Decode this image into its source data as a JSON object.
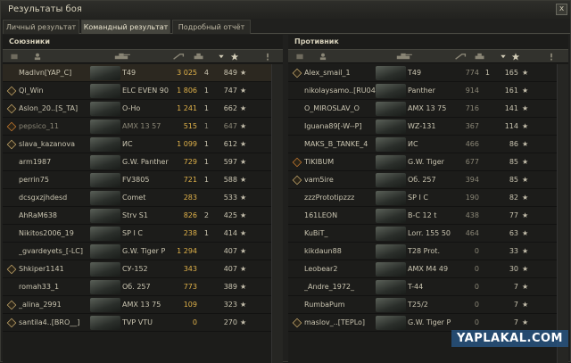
{
  "window": {
    "title": "Результаты боя",
    "close": "x"
  },
  "tabs": [
    {
      "label": "Личный результат",
      "active": false
    },
    {
      "label": "Командный результат",
      "active": true
    },
    {
      "label": "Подробный отчёт",
      "active": false
    }
  ],
  "allies": {
    "title": "Союзники",
    "players": [
      {
        "name": "Madlvn[YAP_C]",
        "tank": "T49",
        "dmg": "3 025",
        "kills": "4",
        "xp": "849",
        "badge": "none",
        "highlight": true
      },
      {
        "name": "Ql_Win",
        "tank": "ELC EVEN 90",
        "dmg": "1 806",
        "kills": "1",
        "xp": "747",
        "badge": "gold"
      },
      {
        "name": "Aslon_20..[S_TA]",
        "tank": "O-Ho",
        "dmg": "1 241",
        "kills": "1",
        "xp": "662",
        "badge": "gold"
      },
      {
        "name": "pepsico_11",
        "tank": "AMX 13 57",
        "dmg": "515",
        "kills": "1",
        "xp": "647",
        "badge": "orange",
        "dead": true
      },
      {
        "name": "slava_kazanova",
        "tank": "ИС",
        "dmg": "1 099",
        "kills": "1",
        "xp": "612",
        "badge": "gold"
      },
      {
        "name": "arm1987",
        "tank": "G.W. Panther",
        "dmg": "729",
        "kills": "1",
        "xp": "597",
        "badge": "none"
      },
      {
        "name": "perrin75",
        "tank": "FV3805",
        "dmg": "721",
        "kills": "1",
        "xp": "588",
        "badge": "none"
      },
      {
        "name": "dcsgxzjhdesd",
        "tank": "Comet",
        "dmg": "283",
        "kills": "",
        "xp": "533",
        "badge": "none"
      },
      {
        "name": "AhRaM638",
        "tank": "Strv S1",
        "dmg": "826",
        "kills": "2",
        "xp": "425",
        "badge": "none"
      },
      {
        "name": "Nikitos2006_19",
        "tank": "SP I C",
        "dmg": "238",
        "kills": "1",
        "xp": "414",
        "badge": "none"
      },
      {
        "name": "_gvardeyets_[-LC]",
        "tank": "G.W. Tiger P",
        "dmg": "1 294",
        "kills": "",
        "xp": "407",
        "badge": "none"
      },
      {
        "name": "Shkiper1141",
        "tank": "СУ-152",
        "dmg": "343",
        "kills": "",
        "xp": "407",
        "badge": "gold"
      },
      {
        "name": "romah33_1",
        "tank": "Об. 257",
        "dmg": "773",
        "kills": "",
        "xp": "389",
        "badge": "none"
      },
      {
        "name": "_alina_2991",
        "tank": "AMX 13 75",
        "dmg": "109",
        "kills": "",
        "xp": "323",
        "badge": "gold"
      },
      {
        "name": "santila4..[BRO__]",
        "tank": "TVP VTU",
        "dmg": "0",
        "kills": "",
        "xp": "270",
        "badge": "gold"
      }
    ]
  },
  "enemies": {
    "title": "Противник",
    "players": [
      {
        "name": "Alex_smail_1",
        "tank": "T49",
        "dmg": "774",
        "kills": "1",
        "xp": "165",
        "badge": "gold"
      },
      {
        "name": "nikolaysamo..[RU045]",
        "tank": "Panther",
        "dmg": "914",
        "kills": "",
        "xp": "161",
        "badge": "none"
      },
      {
        "name": "O_MIROSLAV_O",
        "tank": "AMX 13 75",
        "dmg": "716",
        "kills": "",
        "xp": "141",
        "badge": "none"
      },
      {
        "name": "Iguana89[-W--P]",
        "tank": "WZ-131",
        "dmg": "367",
        "kills": "",
        "xp": "114",
        "badge": "none"
      },
      {
        "name": "MAKS_B_TANKE_4",
        "tank": "ИС",
        "dmg": "466",
        "kills": "",
        "xp": "86",
        "badge": "none"
      },
      {
        "name": "TIKIBUM",
        "tank": "G.W. Tiger",
        "dmg": "677",
        "kills": "",
        "xp": "85",
        "badge": "orange"
      },
      {
        "name": "vam5ire",
        "tank": "Об. 257",
        "dmg": "394",
        "kills": "",
        "xp": "85",
        "badge": "gold"
      },
      {
        "name": "zzzPrototipzzz",
        "tank": "SP I C",
        "dmg": "190",
        "kills": "",
        "xp": "82",
        "badge": "none"
      },
      {
        "name": "161LEON",
        "tank": "B-C 12 t",
        "dmg": "438",
        "kills": "",
        "xp": "77",
        "badge": "none"
      },
      {
        "name": "KuBiT_",
        "tank": "Lorr. 155 50",
        "dmg": "464",
        "kills": "",
        "xp": "63",
        "badge": "none"
      },
      {
        "name": "kikdaun88",
        "tank": "T28 Prot.",
        "dmg": "0",
        "kills": "",
        "xp": "33",
        "badge": "none"
      },
      {
        "name": "Leobear2",
        "tank": "AMX M4 49",
        "dmg": "0",
        "kills": "",
        "xp": "30",
        "badge": "none"
      },
      {
        "name": "_Andre_1972_",
        "tank": "T-44",
        "dmg": "0",
        "kills": "",
        "xp": "7",
        "badge": "none"
      },
      {
        "name": "RumbaPum",
        "tank": "T25/2",
        "dmg": "0",
        "kills": "",
        "xp": "7",
        "badge": "none"
      },
      {
        "name": "maslov_..[TEPLo]",
        "tank": "G.W. Tiger P",
        "dmg": "0",
        "kills": "",
        "xp": "7",
        "badge": "gold"
      }
    ]
  },
  "watermark": "YAPLAKAL.COM",
  "star_glyph": "★"
}
